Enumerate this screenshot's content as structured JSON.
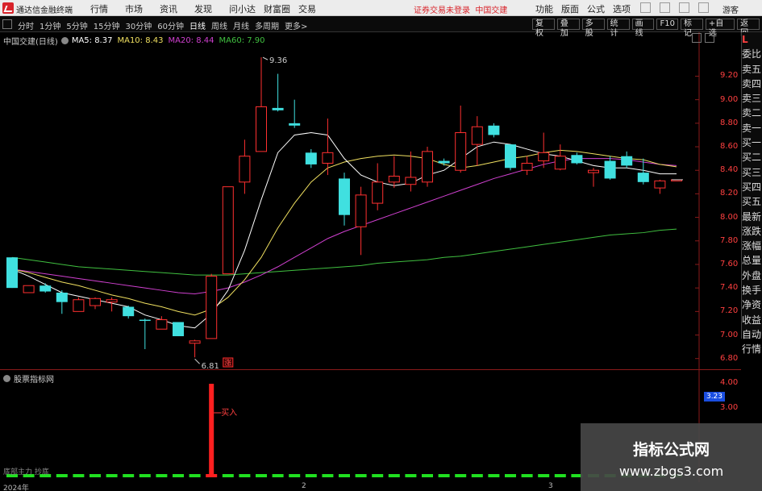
{
  "window": {
    "app_name": "通达信金融终端",
    "menu": [
      "行情",
      "市场",
      "资讯",
      "发现",
      "问小达",
      "财富圈",
      "交易"
    ],
    "notice": "证券交易未登录",
    "stock_tab": "中国交建",
    "right_menu": [
      "功能",
      "版面",
      "公式",
      "选项"
    ],
    "guest": "游客"
  },
  "toolbar": {
    "periods": [
      "分时",
      "1分钟",
      "5分钟",
      "15分钟",
      "30分钟",
      "60分钟",
      "日线",
      "周线",
      "月线",
      "多周期",
      "更多>"
    ],
    "active_period": "日线",
    "buttons": [
      "复权",
      "叠加",
      "多股",
      "统计",
      "画线",
      "F10",
      "标记",
      "+自选",
      "返回"
    ]
  },
  "chart_header": {
    "stock": "中国交建(日线)",
    "ma": [
      {
        "label": "MA5: 8.37",
        "color": "#ffffff"
      },
      {
        "label": "MA10: 8.43",
        "color": "#f0e060"
      },
      {
        "label": "MA20: 8.44",
        "color": "#d040d0"
      },
      {
        "label": "MA60: 7.90",
        "color": "#40c040"
      }
    ]
  },
  "sidebar": {
    "top_badge": "L",
    "items": [
      "委比",
      "卖五",
      "卖四",
      "卖三",
      "卖二",
      "卖一",
      "买一",
      "买二",
      "买三",
      "买四",
      "买五",
      "最新",
      "涨跌",
      "涨幅",
      "总量",
      "外盘",
      "换手",
      "净资",
      "收益",
      "自动",
      "行情"
    ]
  },
  "chart_data": {
    "type": "candlestick",
    "y_ticks": [
      "9.20",
      "9.00",
      "8.80",
      "8.60",
      "8.40",
      "8.20",
      "8.00",
      "7.80",
      "7.60",
      "7.40",
      "7.20",
      "7.00",
      "6.80"
    ],
    "ylim": [
      6.75,
      9.45
    ],
    "high_label": "9.36",
    "low_label": "6.81",
    "candles": [
      {
        "o": 7.66,
        "h": 7.66,
        "l": 7.4,
        "c": 7.4,
        "up": false
      },
      {
        "o": 7.36,
        "h": 7.42,
        "l": 7.36,
        "c": 7.42,
        "up": true
      },
      {
        "o": 7.42,
        "h": 7.44,
        "l": 7.36,
        "c": 7.37,
        "up": false
      },
      {
        "o": 7.36,
        "h": 7.38,
        "l": 7.18,
        "c": 7.28,
        "up": false
      },
      {
        "o": 7.2,
        "h": 7.32,
        "l": 7.2,
        "c": 7.3,
        "up": true
      },
      {
        "o": 7.25,
        "h": 7.32,
        "l": 7.22,
        "c": 7.31,
        "up": true
      },
      {
        "o": 7.3,
        "h": 7.32,
        "l": 7.2,
        "c": 7.28,
        "up": true
      },
      {
        "o": 7.24,
        "h": 7.25,
        "l": 7.14,
        "c": 7.16,
        "up": false
      },
      {
        "o": 7.13,
        "h": 7.14,
        "l": 6.88,
        "c": 7.12,
        "up": false
      },
      {
        "o": 7.05,
        "h": 7.16,
        "l": 7.05,
        "c": 7.13,
        "up": true
      },
      {
        "o": 7.11,
        "h": 7.11,
        "l": 6.99,
        "c": 6.99,
        "up": false
      },
      {
        "o": 6.93,
        "h": 6.96,
        "l": 6.81,
        "c": 6.95,
        "up": true
      },
      {
        "o": 6.97,
        "h": 7.52,
        "l": 6.97,
        "c": 7.5,
        "up": true
      },
      {
        "o": 7.52,
        "h": 8.26,
        "l": 7.52,
        "c": 8.26,
        "up": true
      },
      {
        "o": 8.3,
        "h": 8.66,
        "l": 8.2,
        "c": 8.52,
        "up": true
      },
      {
        "o": 8.56,
        "h": 9.36,
        "l": 8.56,
        "c": 8.94,
        "up": true
      },
      {
        "o": 8.93,
        "h": 9.22,
        "l": 8.9,
        "c": 8.91,
        "up": false
      },
      {
        "o": 8.8,
        "h": 9.0,
        "l": 8.76,
        "c": 8.78,
        "up": false
      },
      {
        "o": 8.55,
        "h": 8.58,
        "l": 8.42,
        "c": 8.45,
        "up": false
      },
      {
        "o": 8.46,
        "h": 8.84,
        "l": 8.36,
        "c": 8.55,
        "up": true
      },
      {
        "o": 8.33,
        "h": 8.38,
        "l": 7.93,
        "c": 8.02,
        "up": false
      },
      {
        "o": 7.92,
        "h": 8.26,
        "l": 7.68,
        "c": 8.19,
        "up": true
      },
      {
        "o": 8.12,
        "h": 8.46,
        "l": 8.06,
        "c": 8.3,
        "up": true
      },
      {
        "o": 8.3,
        "h": 8.52,
        "l": 8.25,
        "c": 8.35,
        "up": true
      },
      {
        "o": 8.28,
        "h": 8.56,
        "l": 8.22,
        "c": 8.34,
        "up": true
      },
      {
        "o": 8.3,
        "h": 8.6,
        "l": 8.26,
        "c": 8.56,
        "up": true
      },
      {
        "o": 8.48,
        "h": 8.5,
        "l": 8.44,
        "c": 8.46,
        "up": false
      },
      {
        "o": 8.4,
        "h": 8.95,
        "l": 8.38,
        "c": 8.72,
        "up": true
      },
      {
        "o": 8.62,
        "h": 8.86,
        "l": 8.44,
        "c": 8.77,
        "up": true
      },
      {
        "o": 8.78,
        "h": 8.8,
        "l": 8.68,
        "c": 8.7,
        "up": false
      },
      {
        "o": 8.62,
        "h": 8.62,
        "l": 8.4,
        "c": 8.42,
        "up": false
      },
      {
        "o": 8.4,
        "h": 8.52,
        "l": 8.36,
        "c": 8.46,
        "up": true
      },
      {
        "o": 8.48,
        "h": 8.72,
        "l": 8.42,
        "c": 8.55,
        "up": true
      },
      {
        "o": 8.52,
        "h": 8.62,
        "l": 8.4,
        "c": 8.41,
        "up": true
      },
      {
        "o": 8.53,
        "h": 8.55,
        "l": 8.45,
        "c": 8.46,
        "up": false
      },
      {
        "o": 8.4,
        "h": 8.42,
        "l": 8.26,
        "c": 8.38,
        "up": true
      },
      {
        "o": 8.48,
        "h": 8.52,
        "l": 8.32,
        "c": 8.33,
        "up": false
      },
      {
        "o": 8.52,
        "h": 8.56,
        "l": 8.42,
        "c": 8.44,
        "up": false
      },
      {
        "o": 8.38,
        "h": 8.5,
        "l": 8.28,
        "c": 8.3,
        "up": false
      },
      {
        "o": 8.25,
        "h": 8.32,
        "l": 8.2,
        "c": 8.31,
        "up": true
      },
      {
        "o": 8.32,
        "h": 8.32,
        "l": 8.32,
        "c": 8.32,
        "up": true
      }
    ],
    "ma5": [
      7.56,
      7.5,
      7.43,
      7.36,
      7.33,
      7.3,
      7.27,
      7.24,
      7.17,
      7.13,
      7.08,
      7.06,
      7.18,
      7.38,
      7.72,
      8.15,
      8.55,
      8.7,
      8.72,
      8.7,
      8.5,
      8.36,
      8.3,
      8.27,
      8.29,
      8.36,
      8.4,
      8.5,
      8.6,
      8.64,
      8.62,
      8.58,
      8.54,
      8.52,
      8.48,
      8.44,
      8.42,
      8.42,
      8.4,
      8.37,
      8.37
    ],
    "ma10": [
      7.56,
      7.53,
      7.49,
      7.45,
      7.42,
      7.38,
      7.34,
      7.31,
      7.27,
      7.24,
      7.2,
      7.17,
      7.22,
      7.32,
      7.47,
      7.66,
      7.91,
      8.12,
      8.3,
      8.42,
      8.47,
      8.5,
      8.52,
      8.53,
      8.52,
      8.5,
      8.45,
      8.42,
      8.44,
      8.47,
      8.5,
      8.52,
      8.55,
      8.57,
      8.56,
      8.54,
      8.52,
      8.5,
      8.49,
      8.45,
      8.43
    ],
    "ma20": [
      7.56,
      7.54,
      7.52,
      7.5,
      7.48,
      7.46,
      7.44,
      7.42,
      7.4,
      7.38,
      7.36,
      7.35,
      7.37,
      7.4,
      7.45,
      7.51,
      7.58,
      7.66,
      7.74,
      7.82,
      7.88,
      7.93,
      7.98,
      8.03,
      8.08,
      8.13,
      8.18,
      8.23,
      8.28,
      8.33,
      8.37,
      8.41,
      8.45,
      8.48,
      8.5,
      8.5,
      8.5,
      8.49,
      8.47,
      8.45,
      8.44
    ],
    "ma60": [
      7.66,
      7.64,
      7.62,
      7.6,
      7.58,
      7.57,
      7.56,
      7.55,
      7.54,
      7.53,
      7.52,
      7.51,
      7.51,
      7.51,
      7.52,
      7.53,
      7.54,
      7.55,
      7.56,
      7.57,
      7.58,
      7.59,
      7.61,
      7.62,
      7.63,
      7.64,
      7.66,
      7.67,
      7.69,
      7.71,
      7.73,
      7.75,
      7.77,
      7.79,
      7.81,
      7.83,
      7.85,
      7.86,
      7.87,
      7.89,
      7.9
    ],
    "up_color": "#ff3030",
    "down_color": "#40e0e0",
    "special_marker": "涨"
  },
  "indicator": {
    "name": "股票指标网",
    "y_ticks": [
      "4.00",
      "3.00"
    ],
    "current_value": "3.23",
    "signal_label": "买入",
    "signal_index": 12,
    "bottom_label": "底部主力 抄底"
  },
  "dates": [
    "2024年",
    "2",
    "3"
  ],
  "watermark": {
    "line1": "指标公式网",
    "line2": "www.zbgs3.com"
  }
}
